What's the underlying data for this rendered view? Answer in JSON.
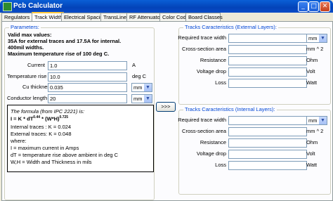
{
  "window": {
    "title": "Pcb Calculator",
    "min": "_",
    "max": "□",
    "close": "✕"
  },
  "tabs": [
    "Regulators",
    "Track Width",
    "Electrical Spacing",
    "TransLine",
    "RF Attenuators",
    "Color Code",
    "Board Classes"
  ],
  "params": {
    "legend": "Parameters:",
    "info": [
      "Valid max values:",
      "35A for external traces and 17.5A for internal.",
      "400mil widths.",
      "Maximum temperature rise of 100 deg C."
    ],
    "current": {
      "label": "Current",
      "value": "1.0",
      "unit": "A"
    },
    "temp": {
      "label": "Temperature rise",
      "value": "10.0",
      "unit": "deg C"
    },
    "cu": {
      "label": "Cu thickness",
      "value": "0.035",
      "unit": "mm"
    },
    "length": {
      "label": "Conductor length",
      "value": "20",
      "unit": "mm"
    }
  },
  "formula": {
    "intro": "The formula (from IPC 2221) is:",
    "main_prefix": "I = K * dT",
    "exp1": "0.44",
    "main_mid": " * (W*H)",
    "exp2": "0.725",
    "internal": "Internal traces : K = 0.024",
    "external": "External traces: K = 0.048",
    "where": "where:",
    "i_def": "I = maximum current in Amps",
    "dt_def": "dT = temperature rise above ambient in deg C",
    "wh_def": "W,H = Width and Thickness in mils"
  },
  "arrow_button": ">>>",
  "external": {
    "legend": "Tracks Caracteristics (External Layers):",
    "rows": [
      {
        "label": "Required trace width",
        "unit": "mm",
        "value": ""
      },
      {
        "label": "Cross-section area",
        "unit": "mm ^ 2",
        "value": ""
      },
      {
        "label": "Resistance",
        "unit": "Ohm",
        "value": ""
      },
      {
        "label": "Voltage drop",
        "unit": "Volt",
        "value": ""
      },
      {
        "label": "Loss",
        "unit": "Watt",
        "value": ""
      }
    ]
  },
  "internal": {
    "legend": "Tracks Caracteristics (Internal Layers):",
    "rows": [
      {
        "label": "Required trace width",
        "unit": "mm",
        "value": ""
      },
      {
        "label": "Cross-section area",
        "unit": "mm ^ 2",
        "value": ""
      },
      {
        "label": "Resistance",
        "unit": "Ohm",
        "value": ""
      },
      {
        "label": "Voltage drop",
        "unit": "Volt",
        "value": ""
      },
      {
        "label": "Loss",
        "unit": "Watt",
        "value": ""
      }
    ]
  },
  "colors": {
    "titlebar": "#0343b8",
    "legend": "#0046d5",
    "active_tab_accent": "#ffc83c"
  }
}
